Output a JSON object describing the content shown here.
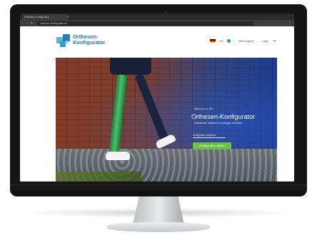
{
  "browser": {
    "tab_title": "Orthesen-Konfigurator",
    "tab_close": "×",
    "nav_icons": [
      "back-icon",
      "forward-icon",
      "reload-icon"
    ],
    "address": "orthesen-konfigurator.de",
    "menu_icon": "⋮"
  },
  "site": {
    "logo_line1": "Orthesen-",
    "logo_line2": "Konfigurator",
    "brand_color": "#2a7bb0",
    "language": "DE",
    "links": {
      "support": "Hilfe/Support",
      "separator": "|",
      "login": "Login"
    }
  },
  "hero": {
    "kicker": "Welcome to the",
    "title": "Orthesen-Konfigurator",
    "subtitle": "Individuelle Orthesen in wenigen Schritten",
    "input_placeholder": "Konfiguration beginnen",
    "cta_label": "Konfiguration starten",
    "cta_color": "#6cc04a"
  }
}
